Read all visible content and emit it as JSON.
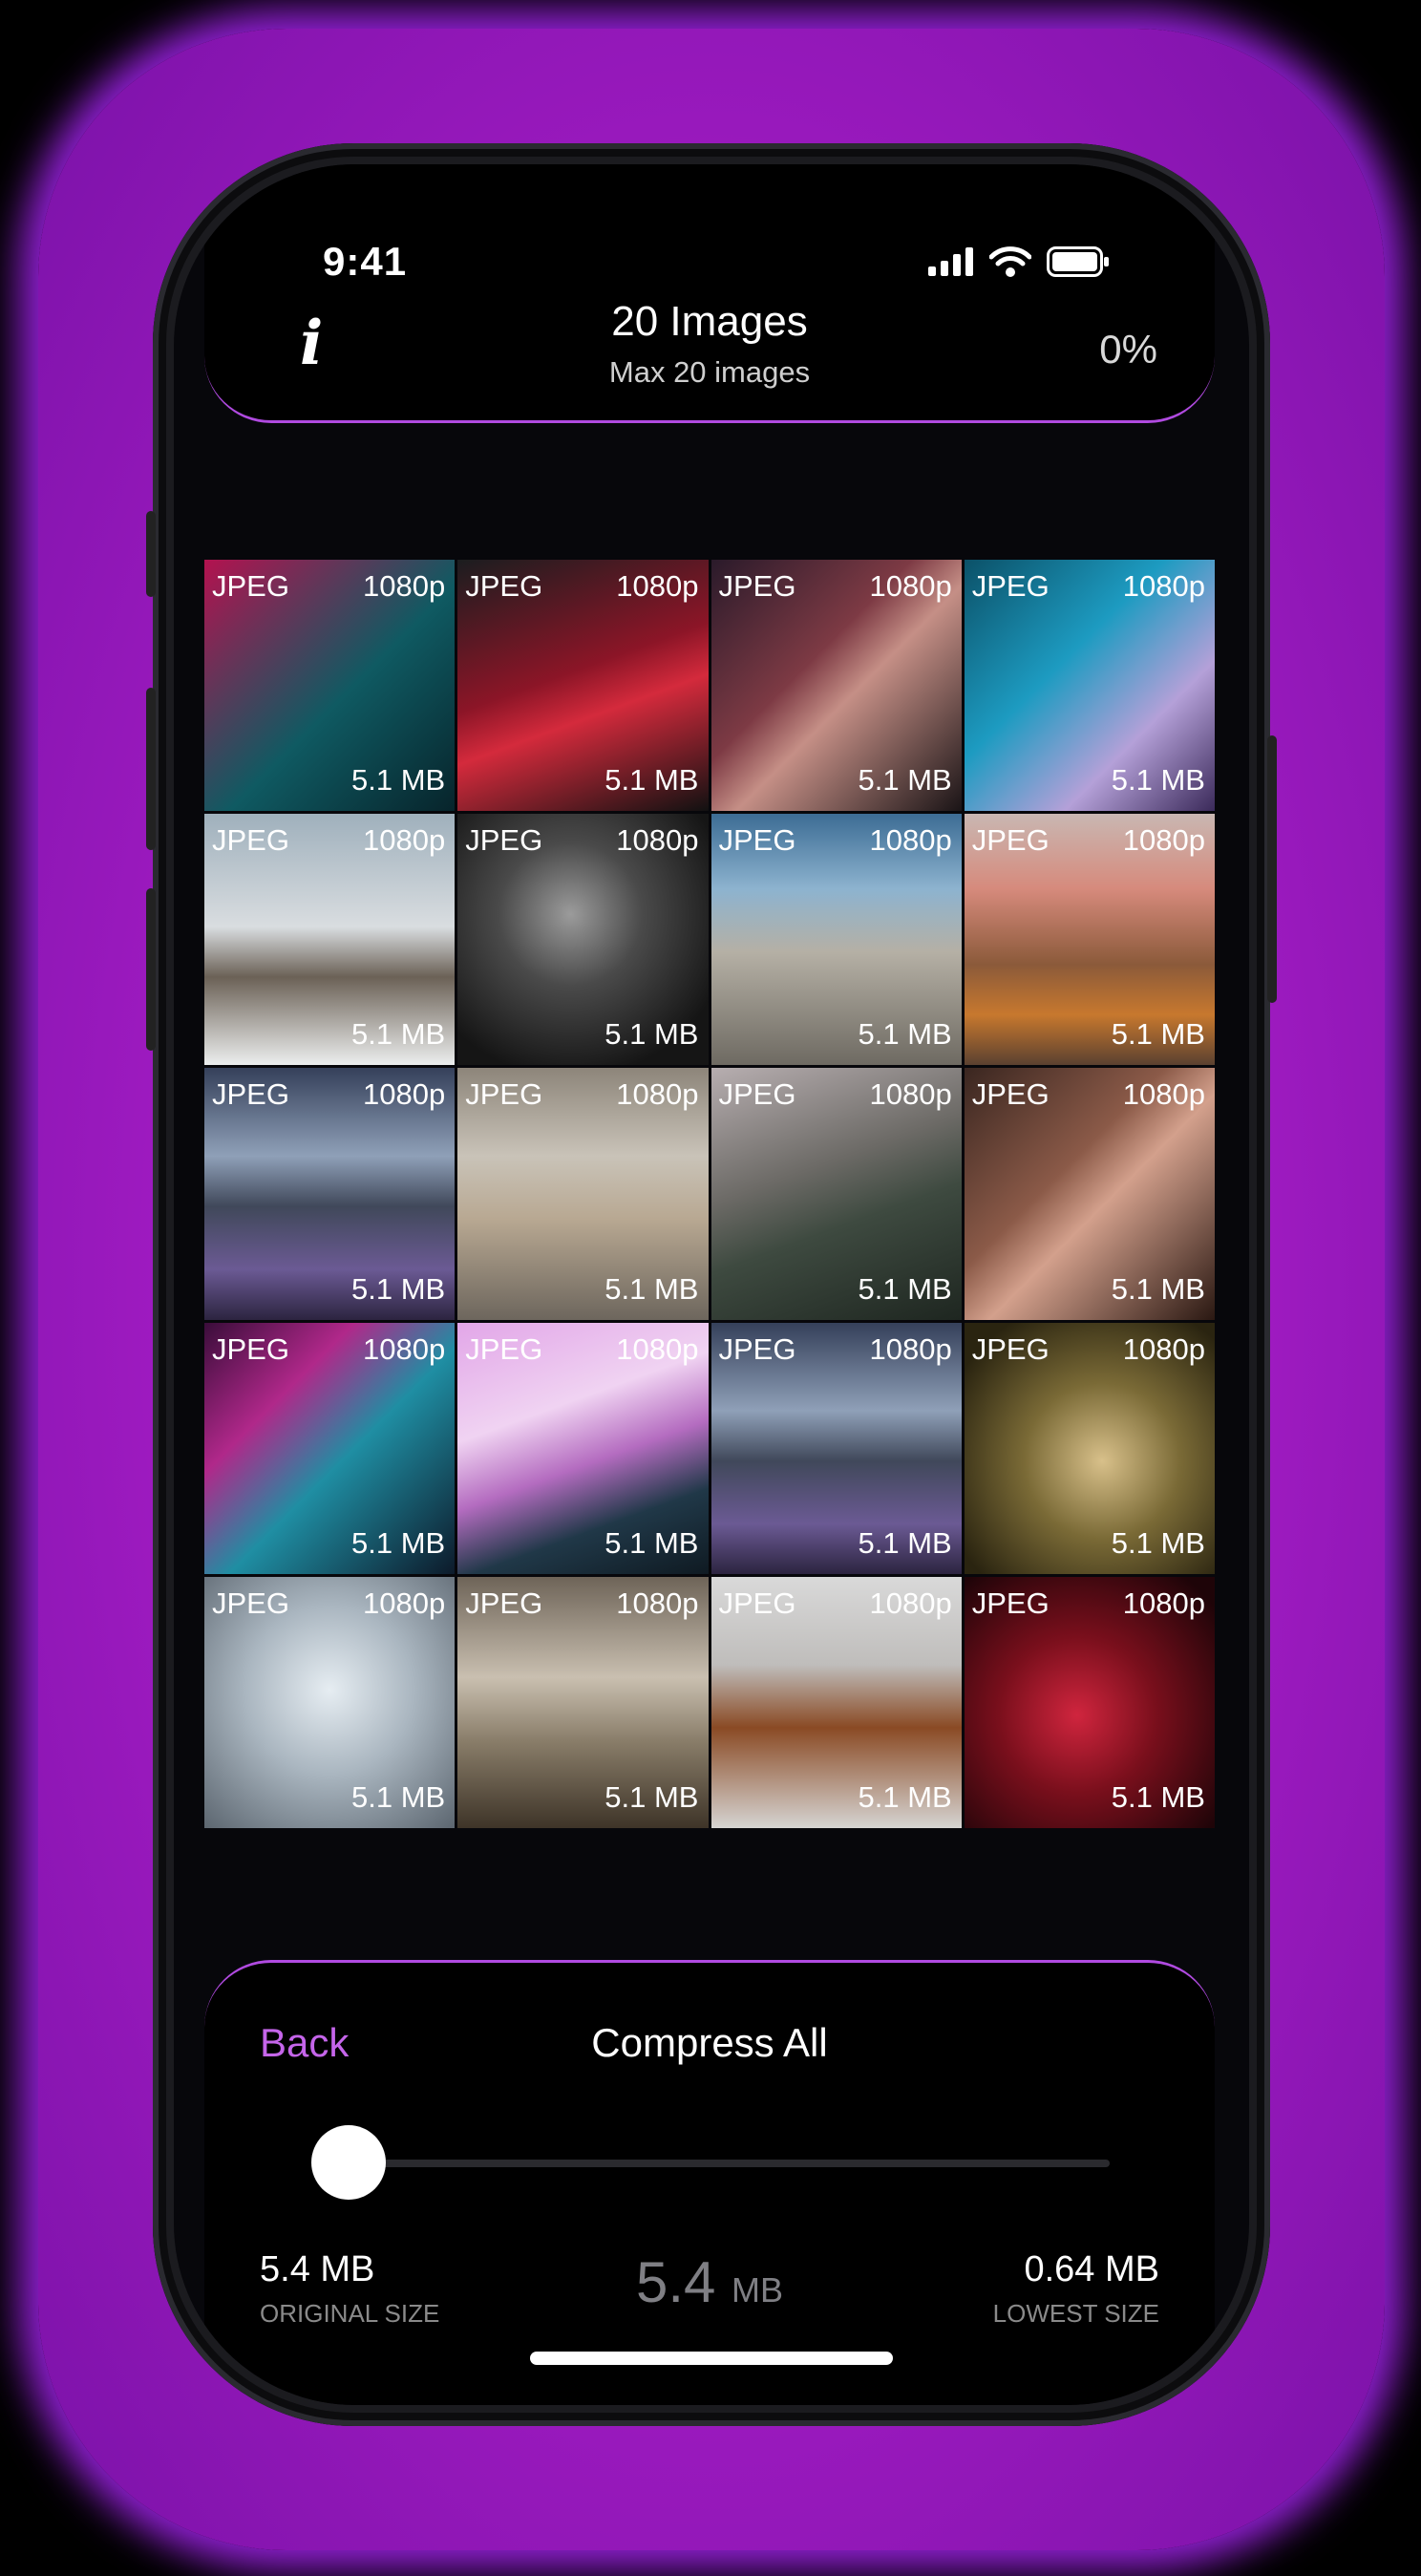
{
  "status": {
    "time": "9:41"
  },
  "header": {
    "title": "20 Images",
    "subtitle": "Max 20 images",
    "progress": "0%"
  },
  "tiles": [
    {
      "format": "JPEG",
      "resolution": "1080p",
      "size": "5.1 MB"
    },
    {
      "format": "JPEG",
      "resolution": "1080p",
      "size": "5.1 MB"
    },
    {
      "format": "JPEG",
      "resolution": "1080p",
      "size": "5.1 MB"
    },
    {
      "format": "JPEG",
      "resolution": "1080p",
      "size": "5.1 MB"
    },
    {
      "format": "JPEG",
      "resolution": "1080p",
      "size": "5.1 MB"
    },
    {
      "format": "JPEG",
      "resolution": "1080p",
      "size": "5.1 MB"
    },
    {
      "format": "JPEG",
      "resolution": "1080p",
      "size": "5.1 MB"
    },
    {
      "format": "JPEG",
      "resolution": "1080p",
      "size": "5.1 MB"
    },
    {
      "format": "JPEG",
      "resolution": "1080p",
      "size": "5.1 MB"
    },
    {
      "format": "JPEG",
      "resolution": "1080p",
      "size": "5.1 MB"
    },
    {
      "format": "JPEG",
      "resolution": "1080p",
      "size": "5.1 MB"
    },
    {
      "format": "JPEG",
      "resolution": "1080p",
      "size": "5.1 MB"
    },
    {
      "format": "JPEG",
      "resolution": "1080p",
      "size": "5.1 MB"
    },
    {
      "format": "JPEG",
      "resolution": "1080p",
      "size": "5.1 MB"
    },
    {
      "format": "JPEG",
      "resolution": "1080p",
      "size": "5.1 MB"
    },
    {
      "format": "JPEG",
      "resolution": "1080p",
      "size": "5.1 MB"
    },
    {
      "format": "JPEG",
      "resolution": "1080p",
      "size": "5.1 MB"
    },
    {
      "format": "JPEG",
      "resolution": "1080p",
      "size": "5.1 MB"
    },
    {
      "format": "JPEG",
      "resolution": "1080p",
      "size": "5.1 MB"
    },
    {
      "format": "JPEG",
      "resolution": "1080p",
      "size": "5.1 MB"
    }
  ],
  "controls": {
    "back_label": "Back",
    "compress_label": "Compress All",
    "slider_level": 0,
    "original_size": "5.4 MB",
    "original_label": "ORIGINAL SIZE",
    "current_value": "5.4",
    "current_unit": "MB",
    "lowest_size": "0.64 MB",
    "lowest_label": "LOWEST SIZE"
  },
  "colors": {
    "accent": "#c565ea",
    "glow": "#b51ed6"
  }
}
